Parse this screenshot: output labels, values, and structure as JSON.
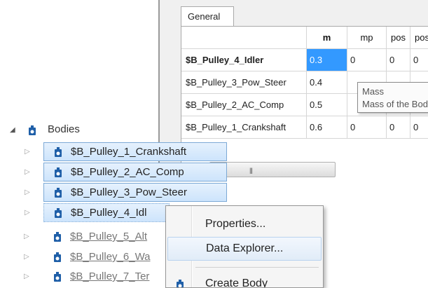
{
  "panel": {
    "tab_label": "General",
    "columns": [
      "m",
      "mp",
      "pos",
      "pos"
    ],
    "rows": [
      {
        "label": "$B_Pulley_4_Idler",
        "m": "0.3",
        "mp": "0",
        "pos1": "0",
        "pos2": "0",
        "active": true
      },
      {
        "label": "$B_Pulley_3_Pow_Steer",
        "m": "0.4",
        "mp": "",
        "pos1": "",
        "pos2": "",
        "active": false
      },
      {
        "label": "$B_Pulley_2_AC_Comp",
        "m": "0.5",
        "mp": "",
        "pos1": "",
        "pos2": "",
        "active": false
      },
      {
        "label": "$B_Pulley_1_Crankshaft",
        "m": "0.6",
        "mp": "0",
        "pos1": "0",
        "pos2": "0",
        "active": false
      }
    ],
    "tooltip": {
      "title": "Mass",
      "description": "Mass of the Body"
    },
    "scrollbar_grip": "|||"
  },
  "tree": {
    "root_label": "Bodies",
    "items": [
      {
        "label": "$B_Pulley_1_Crankshaft",
        "state": "selected"
      },
      {
        "label": "$B_Pulley_2_AC_Comp",
        "state": "selected"
      },
      {
        "label": "$B_Pulley_3_Pow_Steer",
        "state": "selected"
      },
      {
        "label": "$B_Pulley_4_Idl",
        "state": "selected"
      },
      {
        "label": "$B_Pulley_5_Alt",
        "state": "normal"
      },
      {
        "label": "$B_Pulley_6_Wa",
        "state": "normal"
      },
      {
        "label": "$B_Pulley_7_Ter",
        "state": "normal"
      }
    ]
  },
  "context_menu": {
    "items": [
      "Properties...",
      "Data Explorer...",
      "Create Body"
    ]
  },
  "colors": {
    "selection_blue": "#3399ff",
    "tree_selection_border": "#7ca9d6",
    "icon_blue": "#1f5fa8"
  },
  "icons": {
    "node": "body-node-icon",
    "expand": "expand-triangle-icon",
    "collapse": "collapse-triangle-icon"
  }
}
